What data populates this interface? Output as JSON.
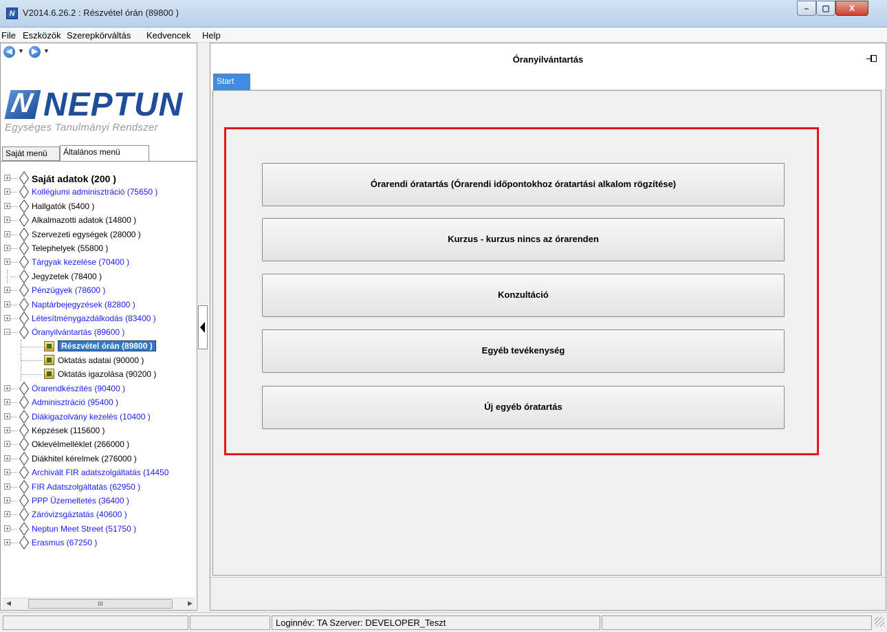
{
  "window": {
    "title": "V2014.6.26.2 : Részvétel órán (89800 )",
    "app_icon_letter": "N",
    "controls": {
      "minimize": "–",
      "maximize": "▢",
      "close": "X"
    }
  },
  "menubar": {
    "items": [
      "File",
      "Eszközök",
      "Szerepkörváltás",
      "Kedvencek",
      "Help"
    ]
  },
  "nav": {
    "back": "◀",
    "forward": "▶",
    "caret": "▼"
  },
  "logo": {
    "name": "NEPTUN",
    "subtitle": "Egységes Tanulmányi Rendszer"
  },
  "menu_tabs": [
    "Saját menü",
    "Általános menü"
  ],
  "tree": [
    {
      "label": "Saját adatok (200 )",
      "style": "bold",
      "expander": "+"
    },
    {
      "label": "Kollégiumi adminisztráció (75650 )",
      "style": "blue",
      "expander": "+"
    },
    {
      "label": "Hallgatók (5400 )",
      "style": "black",
      "expander": "+"
    },
    {
      "label": "Alkalmazotti adatok (14800 )",
      "style": "black",
      "expander": "+"
    },
    {
      "label": "Szervezeti egységek (28000 )",
      "style": "black",
      "expander": "+"
    },
    {
      "label": "Telephelyek (55800 )",
      "style": "black",
      "expander": "+"
    },
    {
      "label": "Tárgyak kezelése (70400 )",
      "style": "blue",
      "expander": "+"
    },
    {
      "label": "Jegyzetek (78400 )",
      "style": "black",
      "expander": ""
    },
    {
      "label": "Pénzügyek (78600 )",
      "style": "blue",
      "expander": "+"
    },
    {
      "label": "Naptárbejegyzések (82800 )",
      "style": "blue",
      "expander": "+"
    },
    {
      "label": "Létesítménygazdálkodás (83400 )",
      "style": "blue",
      "expander": "+"
    },
    {
      "label": "Óranyilvántartás (89600 )",
      "style": "blue",
      "expander": "−"
    },
    {
      "label": "Részvétel órán (89800 )",
      "style": "child-selected",
      "expander": ""
    },
    {
      "label": "Oktatás adatai (90000 )",
      "style": "child",
      "expander": ""
    },
    {
      "label": "Oktatás igazolása (90200 )",
      "style": "child",
      "expander": ""
    },
    {
      "label": "Órarendkészítés (90400 )",
      "style": "blue",
      "expander": "+"
    },
    {
      "label": "Adminisztráció (95400 )",
      "style": "blue",
      "expander": "+"
    },
    {
      "label": "Diákigazolvány kezelés (10400 )",
      "style": "blue",
      "expander": "+"
    },
    {
      "label": "Képzések (115600 )",
      "style": "black",
      "expander": "+"
    },
    {
      "label": "Oklevélmelléklet (266000 )",
      "style": "black",
      "expander": "+"
    },
    {
      "label": "Diákhitel kérelmek (276000 )",
      "style": "black",
      "expander": "+"
    },
    {
      "label": "Archivált FIR adatszolgáltatás (14450",
      "style": "blue",
      "expander": "+"
    },
    {
      "label": "FIR Adatszolgáltatás (62950 )",
      "style": "blue",
      "expander": "+"
    },
    {
      "label": "PPP Üzemeltetés (36400 )",
      "style": "blue",
      "expander": "+"
    },
    {
      "label": "Záróvizsgáztatás (40600 )",
      "style": "blue",
      "expander": "+"
    },
    {
      "label": "Neptun Meet Street (51750 )",
      "style": "blue",
      "expander": "+"
    },
    {
      "label": "Erasmus (67250 )",
      "style": "blue",
      "expander": "+"
    }
  ],
  "hscroll": {
    "left": "◀",
    "right": "▶",
    "thumb": "III"
  },
  "main": {
    "title": "Óranyilvántartás",
    "tab": "Start",
    "buttons": [
      "Órarendi óratartás (Órarendi időpontokhoz óratartási alkalom rögzítése)",
      "Kurzus - kurzus nincs az órarenden",
      "Konzultáció",
      "Egyéb tevékenység",
      "Új egyéb óratartás"
    ]
  },
  "statusbar": {
    "login": "Loginnév: TA  Szerver: DEVELOPER_Teszt"
  },
  "colors": {
    "highlight_frame": "#e8141a",
    "selection": "#3178c6",
    "tab_active": "#3e8de0",
    "link_blue": "#1a1aff"
  }
}
